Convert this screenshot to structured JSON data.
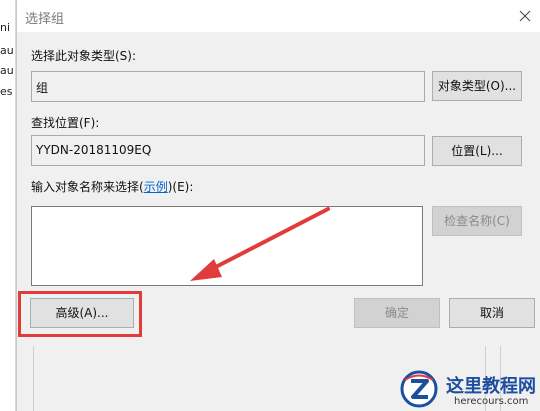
{
  "background_window": {
    "fragments": [
      "ni",
      "au",
      "au",
      "es"
    ]
  },
  "dialog": {
    "title": "选择组",
    "object_type": {
      "label": "选择此对象类型(S):",
      "value": "组",
      "button": "对象类型(O)..."
    },
    "location": {
      "label": "查找位置(F):",
      "value": "YYDN-20181109EQ",
      "button": "位置(L)..."
    },
    "names": {
      "label_prefix": "输入对象名称来选择(",
      "label_link": "示例",
      "label_suffix": ")(E):",
      "value": "",
      "check_button": "检查名称(C)"
    },
    "advanced_button": "高级(A)...",
    "ok_button": "确定",
    "cancel_button": "取消"
  },
  "watermark": {
    "name": "这里教程网",
    "url": "herecours.com"
  },
  "colors": {
    "annotation_red": "#e03c3c",
    "link_blue": "#0066cc",
    "watermark_blue": "#1d4fa0"
  }
}
